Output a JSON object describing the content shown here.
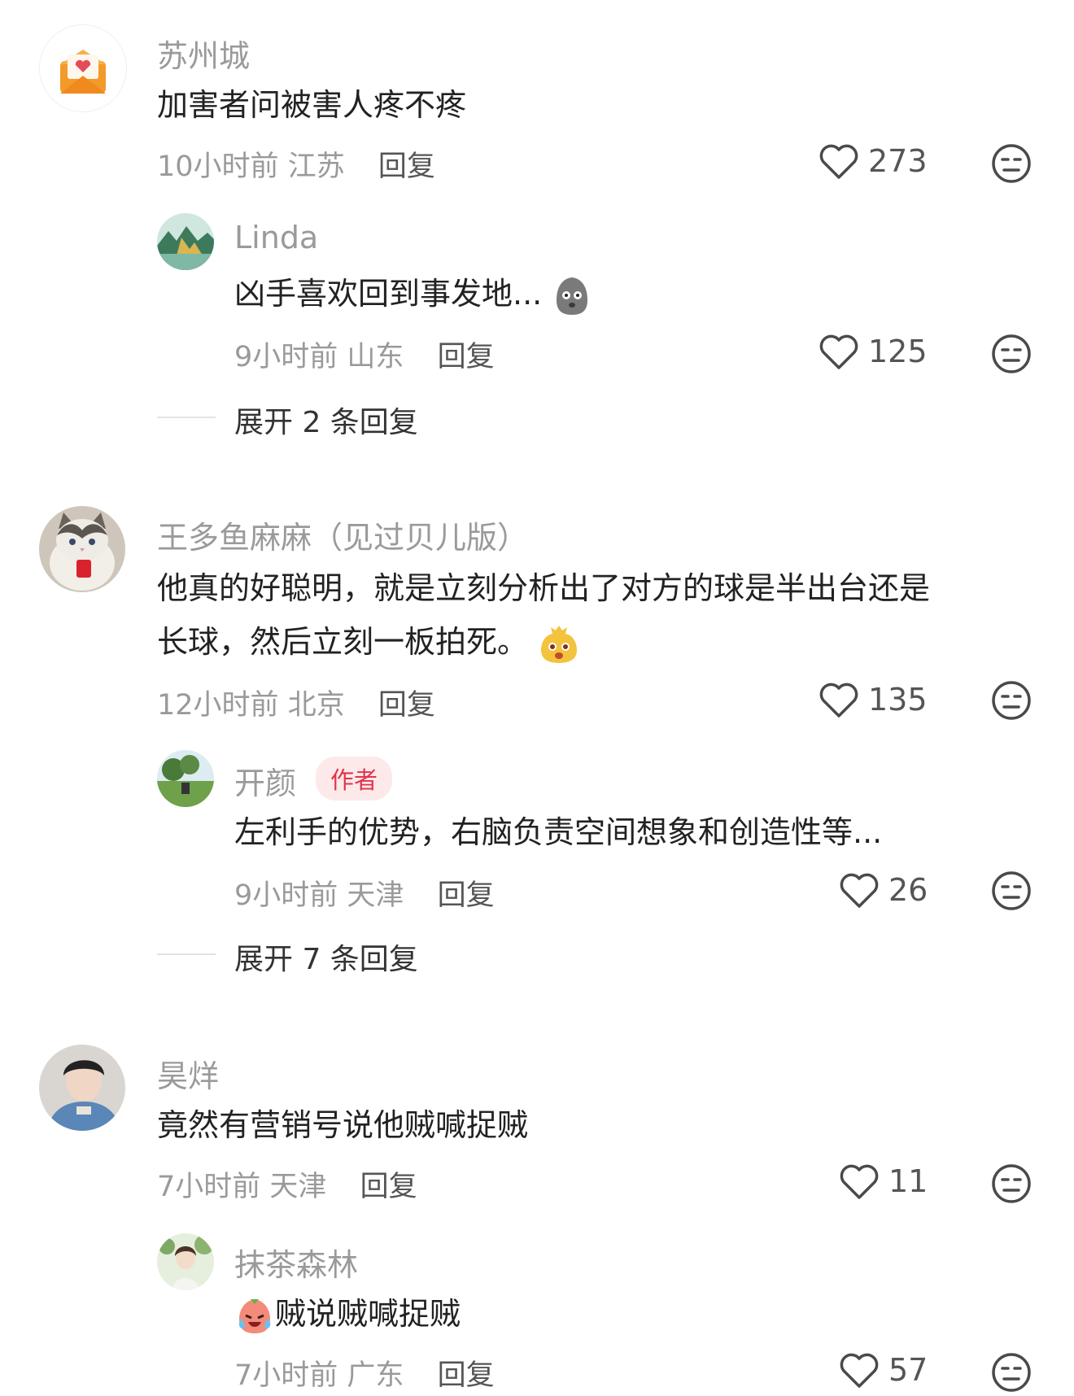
{
  "comments": [
    {
      "user": "苏州城",
      "text": "加害者问被害人疼不疼",
      "time": "10小时前",
      "location": "江苏",
      "reply_label": "回复",
      "likes": "273",
      "replies": [
        {
          "user": "Linda",
          "text": "凶手喜欢回到事发地...",
          "time": "9小时前",
          "location": "山东",
          "reply_label": "回复",
          "likes": "125"
        }
      ],
      "expand_label": "展开 2 条回复"
    },
    {
      "user": "王多鱼麻麻（见过贝儿版）",
      "text_line1": "他真的好聪明，就是立刻分析出了对方的球是半出台还是",
      "text_line2": "长球，然后立刻一板拍死。",
      "time": "12小时前",
      "location": "北京",
      "reply_label": "回复",
      "likes": "135",
      "replies": [
        {
          "user": "开颜",
          "badge": "作者",
          "text": "左利手的优势，右脑负责空间想象和创造性等...",
          "time": "9小时前",
          "location": "天津",
          "reply_label": "回复",
          "likes": "26"
        }
      ],
      "expand_label": "展开 7 条回复"
    },
    {
      "user": "昊烊",
      "text": "竟然有营销号说他贼喊捉贼",
      "time": "7小时前",
      "location": "天津",
      "reply_label": "回复",
      "likes": "11",
      "replies": [
        {
          "user": "抹茶森林",
          "text": "贼说贼喊捉贼",
          "time": "7小时前",
          "location": "广东",
          "reply_label": "回复",
          "likes": "57"
        }
      ]
    }
  ],
  "icons": {
    "like": "heart-outline-icon",
    "dislike": "neutral-face-icon"
  },
  "colors": {
    "author_badge_text": "#e0344a",
    "author_badge_bg": "#fde9ea",
    "name_gray": "#9a9a9a"
  }
}
